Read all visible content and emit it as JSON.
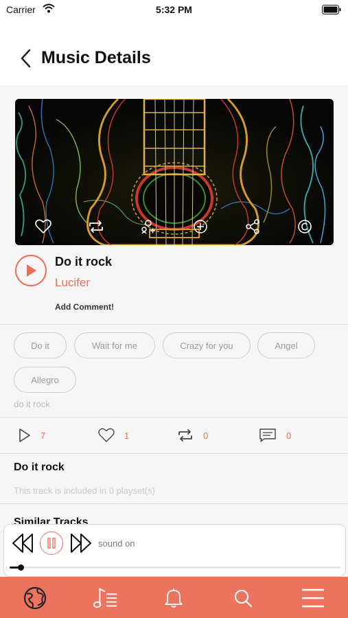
{
  "status_bar": {
    "carrier": "Carrier",
    "time": "5:32 PM"
  },
  "header": {
    "title": "Music Details"
  },
  "cover_actions": [
    "heart-icon",
    "repost-icon",
    "add-user-icon",
    "add-circle-icon",
    "share-icon",
    "copyright-icon"
  ],
  "track": {
    "title": "Do it rock",
    "artist": "Lucifer",
    "add_comment": "Add Comment!"
  },
  "tags": [
    "Do it",
    "Wait for me",
    "Crazy for you",
    "Angel",
    "Allegro"
  ],
  "description": "do it rock",
  "stats": {
    "plays": "7",
    "likes": "1",
    "reposts": "0",
    "comments": "0"
  },
  "playset": {
    "title": "Do it rock",
    "note": "This track is included in 0 playset(s)"
  },
  "similar": {
    "title": "Similar Tracks"
  },
  "player": {
    "sound_label": "sound on",
    "progress": 0.03
  },
  "tabs": [
    "globe-icon",
    "music-list-icon",
    "bell-icon",
    "search-icon",
    "menu-icon"
  ],
  "colors": {
    "accent": "#ec6e57",
    "tab_bar": "#ec735d",
    "background": "#f7f6f7"
  }
}
